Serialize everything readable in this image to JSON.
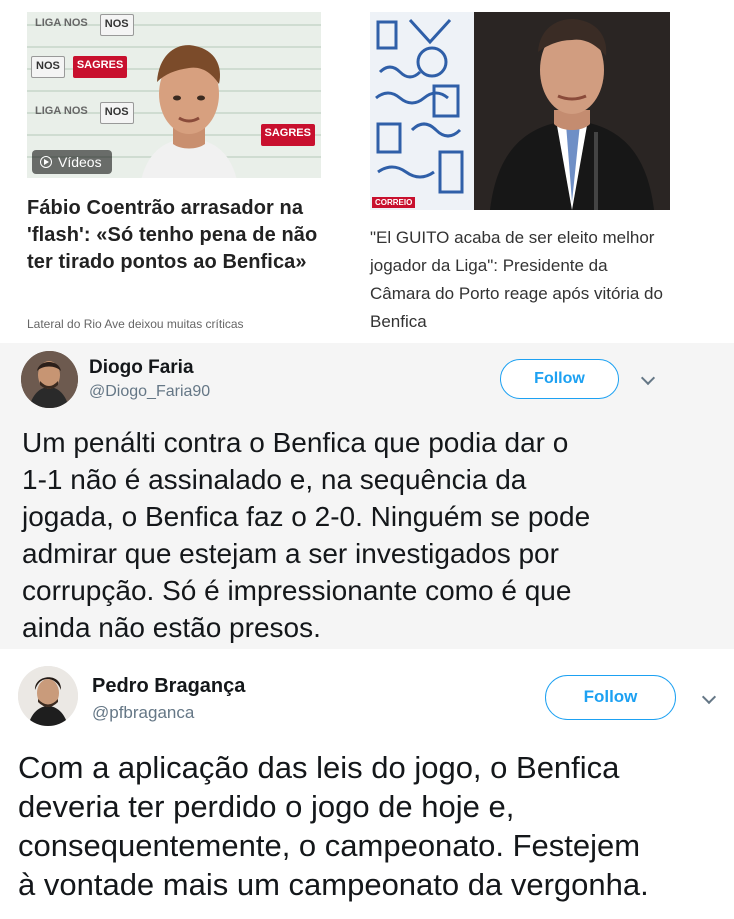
{
  "news": {
    "left_card": {
      "video_badge": "Vídeos",
      "headline": "Fábio Coentrão arrasador na 'flash': «Só tenho pena de não ter tirado pontos ao Benfica»",
      "subtitle": "Lateral do Rio Ave deixou muitas críticas",
      "sponsor_nos": "NOS",
      "sponsor_sagres": "SAGRES",
      "sponsor_liga": "LIGA NOS"
    },
    "right_card": {
      "headline": "\"El GUITO acaba de ser eleito melhor jogador da Liga\": Presidente da Câmara do Porto reage após vitória do Benfica",
      "brand": "CORREIO"
    }
  },
  "tweets": [
    {
      "name": "Diogo Faria",
      "handle": "@Diogo_Faria90",
      "follow_label": "Follow",
      "text": "Um penálti contra o Benfica que podia dar o\n1-1 não é assinalado e, na sequência da\njogada, o Benfica faz o 2-0. Ninguém se pode\nadmirar que estejam a ser investigados por\ncorrupção. Só é impressionante como é que\nainda não estão presos."
    },
    {
      "name": "Pedro Bragança",
      "handle": "@pfbraganca",
      "follow_label": "Follow",
      "text": "Com a aplicação das leis do jogo, o Benfica\ndeveria ter perdido o jogo de hoje e,\nconsequentemente, o campeonato. Festejem\nà vontade mais um campeonato da vergonha."
    }
  ],
  "colors": {
    "twitter_blue": "#1da1f2",
    "text_dark": "#14171a",
    "text_muted": "#657786"
  }
}
